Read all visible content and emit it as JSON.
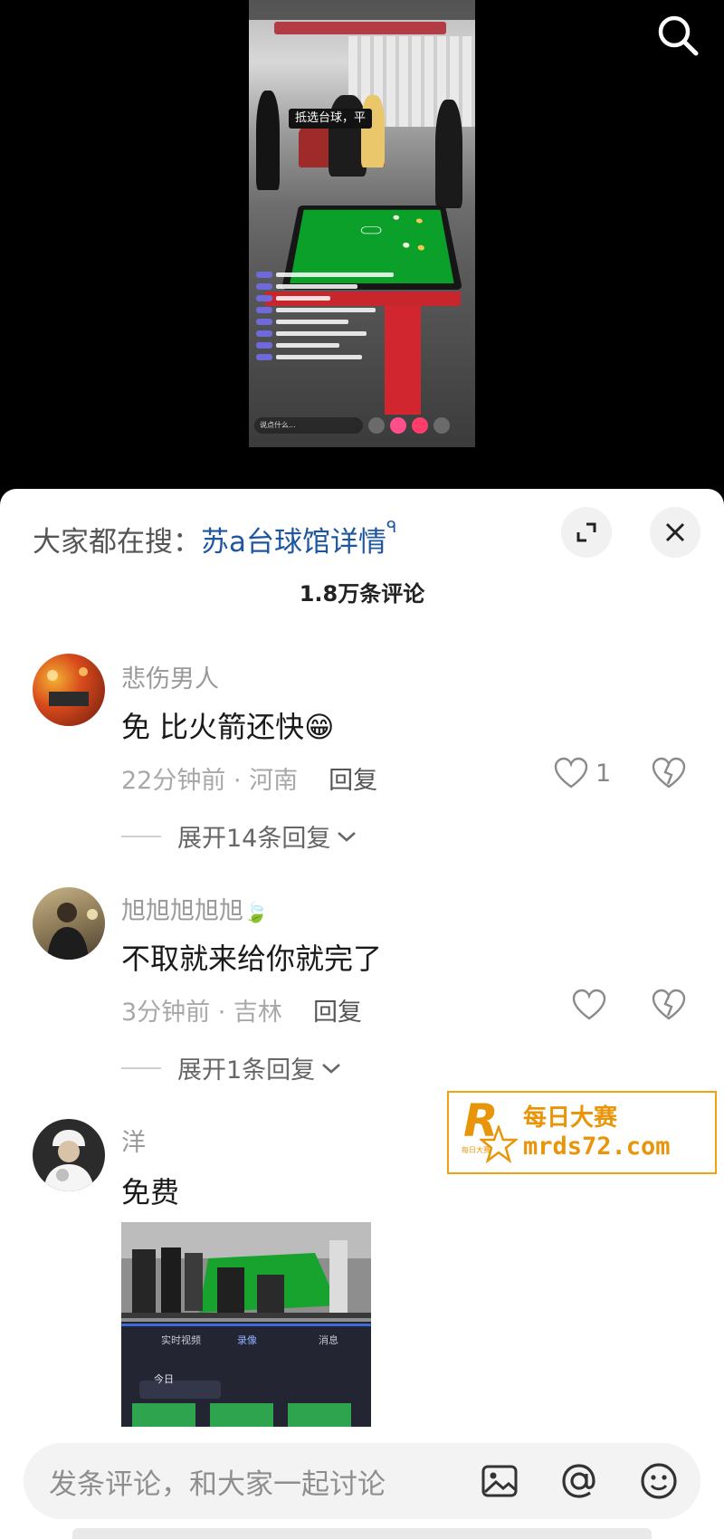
{
  "top_bar": {
    "search_icon": "search-icon"
  },
  "live_preview": {
    "banner": "抵选台球，平",
    "input_placeholder": "说点什么..."
  },
  "sheet": {
    "hot_search_prefix": "大家都在搜：",
    "hot_search_term": "苏a台球馆详情",
    "hot_search_icon": "ᑫ",
    "comment_count": "1.8万条评论",
    "expand_icon": "expand-icon",
    "close_icon": "close-icon"
  },
  "comments": [
    {
      "username": "悲伤男人",
      "text": "免 比火箭还快😁",
      "time_location": "22分钟前 · 河南",
      "reply_label": "回复",
      "like_count": "1",
      "expand_replies": "展开14条回复"
    },
    {
      "username": "旭旭旭旭旭",
      "username_badge": "🍃",
      "text": "不取就来给你就完了",
      "time_location": "3分钟前 · 吉林",
      "reply_label": "回复",
      "like_count": "",
      "expand_replies": "展开1条回复"
    },
    {
      "username": "洋",
      "text": "免费",
      "image_tabs": [
        "实时视频",
        "录像",
        "消息"
      ],
      "image_date": "今日"
    }
  ],
  "watermark": {
    "line1": "每日大赛",
    "line2": "mrds72.com",
    "logo_letter": "R",
    "logo_sub": "每日大赛"
  },
  "input_bar": {
    "placeholder": "发条评论，和大家一起讨论",
    "icons": [
      "image-icon",
      "at-icon",
      "emoji-icon"
    ]
  },
  "colors": {
    "accent_blue": "#1e56a0",
    "watermark_orange": "#e99509",
    "pool_green": "#0aa02a"
  }
}
